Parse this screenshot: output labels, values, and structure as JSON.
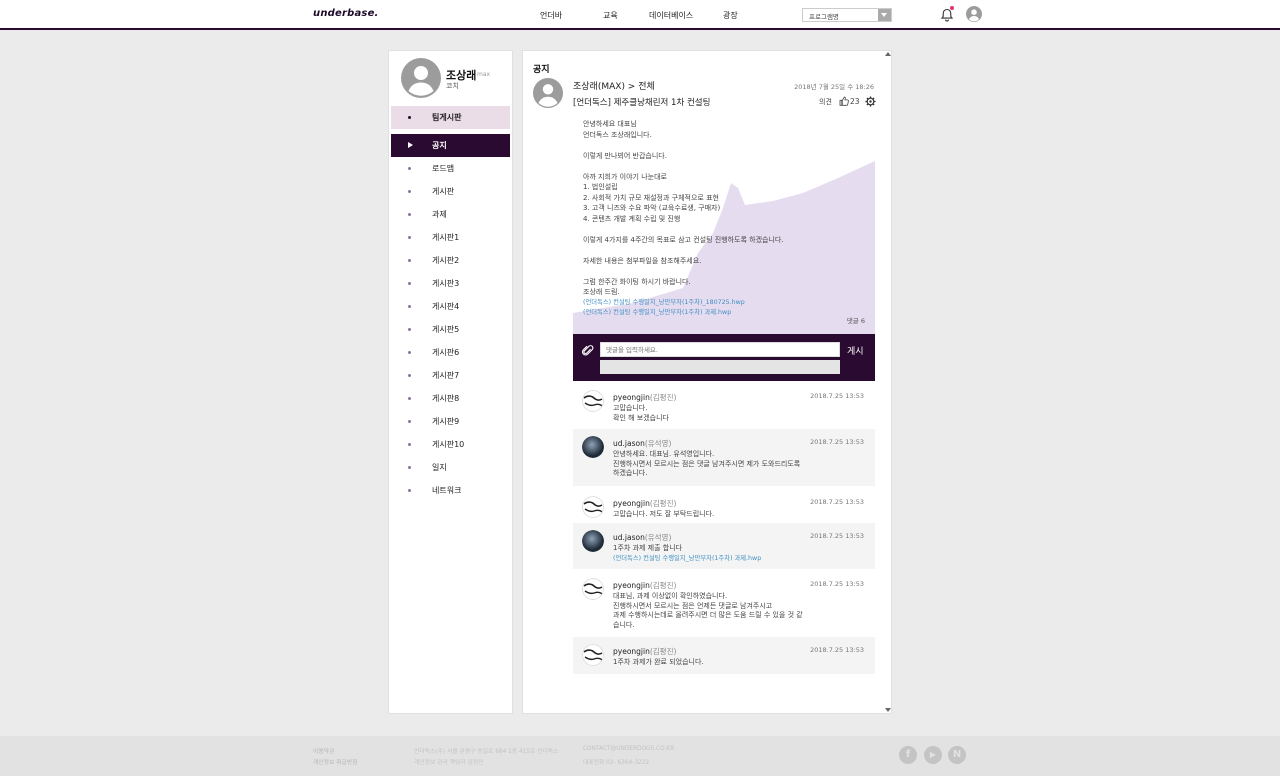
{
  "header": {
    "logo": "underbase.",
    "nav": [
      "언더바",
      "교육",
      "데이터베이스",
      "광장"
    ],
    "program_select": "프로그램명"
  },
  "sidebar": {
    "profile_name": "조상래",
    "profile_nick": "max",
    "profile_role": "코치",
    "team_board": "팀게시판",
    "items": [
      {
        "label": "공지",
        "active": true
      },
      {
        "label": "로드맵"
      },
      {
        "label": "게시판"
      },
      {
        "label": "과제"
      },
      {
        "label": "게시판1"
      },
      {
        "label": "게시판2"
      },
      {
        "label": "게시판3"
      },
      {
        "label": "게시판4"
      },
      {
        "label": "게시판5"
      },
      {
        "label": "게시판6"
      },
      {
        "label": "게시판7"
      },
      {
        "label": "게시판8"
      },
      {
        "label": "게시판9"
      },
      {
        "label": "게시판10"
      },
      {
        "label": "일지"
      },
      {
        "label": "네트워크"
      }
    ]
  },
  "post": {
    "section_title": "공지",
    "author": "조상래(MAX) > 전체",
    "date": "2018년 7월 25일 수 18:26",
    "title": "[언더독스] 제주클낭채린저 1차 컨설팅",
    "opinion_label": "의견",
    "like_count": "23",
    "body_lines": [
      "안녕하세요 대표님",
      "언더독스 조상래입니다.",
      "",
      "이렇게 만나뵈어 반갑습니다.",
      "",
      "아까 지희가 이야기 나눈대로",
      "1. 법인설립",
      "2. 사회적 가치 규모 재설정과 구체적으로 표현",
      "3. 고객 니즈와 수요 파악 (교육수료생, 구매자)",
      "4. 콘텐츠 개발 계획 수립 및 진행",
      "",
      "이렇게 4가지를 4주간의 목표로 삼고 컨설팅 진행하도록 하겠습니다.",
      "",
      "자세한 내용은 첨부파일을 참조해주세요.",
      "",
      "그럼 한주간 화이팅 하시기 바랍니다.",
      "조상래 드림."
    ],
    "attachments": [
      "(언더독스) 컨설팅 수행일지_낭만부자(1주차)_180725.hwp",
      "(언더독스) 컨설팅 수행일지_낭만부자(1주차) 과제.hwp"
    ],
    "comment_count": "댓글 6"
  },
  "comment_form": {
    "placeholder": "댓글을 입력하세요.",
    "submit_label": "게시"
  },
  "comments": [
    {
      "user": "pyeongjin",
      "kname": "(김평진)",
      "date": "2018.7.25 13:53",
      "lines": [
        "고맙습니다.",
        "확인 해 보겠습니다"
      ],
      "link": ""
    },
    {
      "user": "ud.jason",
      "kname": "(유석영)",
      "date": "2018.7.25 13:53",
      "lines": [
        "안녕하세요. 대표님. 유석영입니다.",
        "진행하시면서 모르시는 점은 댓글 남겨주시면 제가 도와드리도록",
        "하겠습니다."
      ],
      "link": ""
    },
    {
      "user": "pyeongjin",
      "kname": "(김평진)",
      "date": "2018.7.25 13:53",
      "lines": [
        "고맙습니다. 저도 잘 부탁드립니다."
      ],
      "link": ""
    },
    {
      "user": "ud.jason",
      "kname": "(유석영)",
      "date": "2018.7.25 13:53",
      "lines": [
        "1주차 과제 제출 합니다"
      ],
      "link": "(언더독스) 컨설팅 수행일지_낭만부자(1주차) 과제.hwp"
    },
    {
      "user": "pyeongjin",
      "kname": "(김평진)",
      "date": "2018.7.25 13:53",
      "lines": [
        "대표님, 과제 이상없이 확인하였습니다.",
        "진행하시면서 모르시는 점은 언제든 댓글로 남겨주시고",
        "과제 수행하시는데로 올려주시면 더 많은 도움 드릴 수 있을 것 같",
        "습니다."
      ],
      "link": ""
    },
    {
      "user": "pyeongjin",
      "kname": "(김평진)",
      "date": "2018.7.25 13:53",
      "lines": [
        "1주차 과제가 완료 되었습니다."
      ],
      "link": ""
    }
  ],
  "footer": {
    "links": [
      "이용약관",
      "개인정보 취급방침"
    ],
    "company": [
      "언더독스(주) 서울 관평구 동일로 684 1동 415호 언더독스",
      "개인정보 관리 책임자 김정민"
    ],
    "contact": [
      "CONTACT@UNDERDOGS.CO.KR",
      "대표전화 02- 6364-3222"
    ],
    "social_icons": [
      "facebook-icon",
      "youtube-icon",
      "naver-icon"
    ]
  },
  "colors": {
    "brand": "#2a0a30",
    "accent_light": "#eadde8",
    "link": "#3f8ec2",
    "content_bg": "#e6dcf0"
  }
}
